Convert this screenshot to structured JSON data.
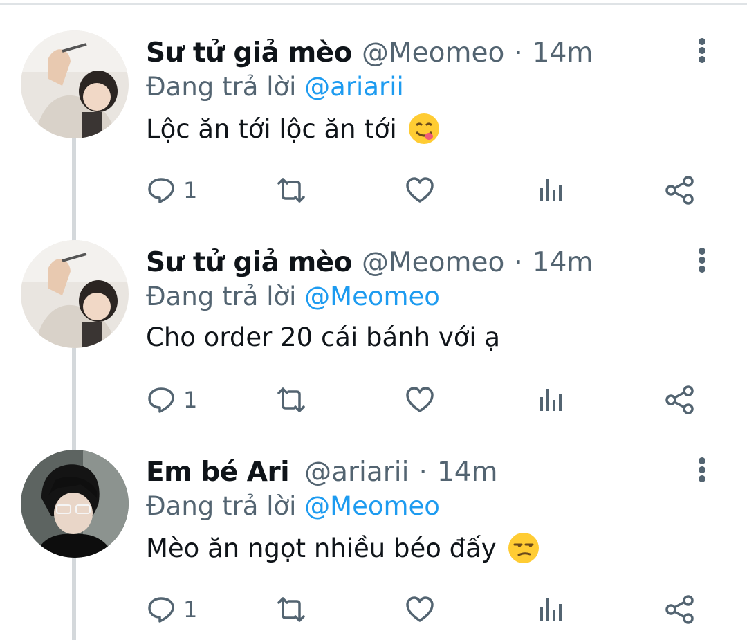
{
  "thread": [
    {
      "name": "Sư tử giả mèo",
      "handle": "@Meomeo",
      "time": "14m",
      "reply_label": "Đang trả lời",
      "reply_to": "@ariarii",
      "text": "Lộc ăn tới lộc ăn tới",
      "emoji": "yum-face-icon",
      "reply_count": "1"
    },
    {
      "name": "Sư tử giả mèo",
      "handle": "@Meomeo",
      "time": "14m",
      "reply_label": "Đang trả lời",
      "reply_to": "@Meomeo",
      "text": "Cho order 20 cái bánh với ạ",
      "emoji": "",
      "reply_count": "1"
    },
    {
      "name": "Em bé Ari",
      "handle": "@ariarii",
      "time": "14m",
      "reply_label": "Đang trả lời",
      "reply_to": "@Meomeo",
      "text": "Mèo ăn ngọt nhiều béo đấy",
      "emoji": "unamused-face-icon",
      "reply_count": "1"
    }
  ],
  "colors": {
    "accent": "#1d9bf0",
    "secondary_text": "#536471",
    "primary_text": "#0f1419",
    "thread_line": "#d4d8db"
  },
  "icons": [
    "reply-icon",
    "retweet-icon",
    "like-icon",
    "views-icon",
    "share-icon",
    "more-options-icon"
  ]
}
